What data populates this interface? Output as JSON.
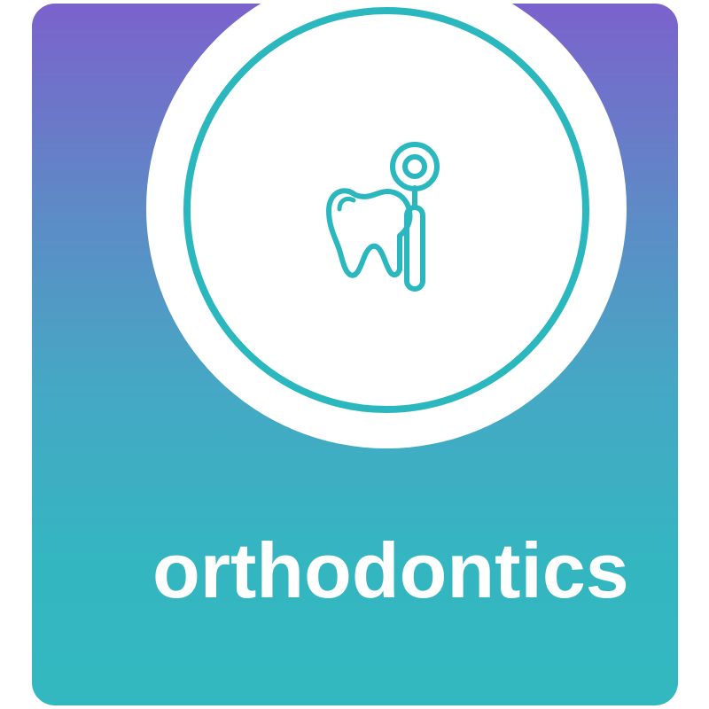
{
  "card": {
    "title": "orthodontics"
  },
  "icon": {
    "name": "tooth-dental-mirror-icon"
  },
  "colors": {
    "gradient_top": "#7b62cc",
    "gradient_bottom": "#33b8c0",
    "accent": "#2ab7be",
    "text": "#ffffff",
    "halo": "#ffffff"
  }
}
